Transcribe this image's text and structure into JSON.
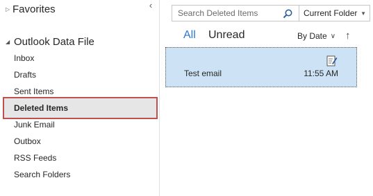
{
  "nav": {
    "favorites_label": "Favorites",
    "group_label": "Outlook Data File",
    "folders": [
      {
        "label": "Inbox"
      },
      {
        "label": "Drafts"
      },
      {
        "label": "Sent Items"
      },
      {
        "label": "Deleted Items",
        "selected": true
      },
      {
        "label": "Junk Email"
      },
      {
        "label": "Outbox"
      },
      {
        "label": "RSS Feeds"
      },
      {
        "label": "Search Folders"
      }
    ]
  },
  "search": {
    "placeholder": "Search Deleted Items",
    "scope_label": "Current Folder"
  },
  "filters": {
    "all_label": "All",
    "unread_label": "Unread",
    "sort_label": "By Date"
  },
  "messages": [
    {
      "subject": "Test email",
      "time": "11:55 AM"
    }
  ],
  "colors": {
    "accent": "#2b78d1",
    "selection_highlight": "#c0504d",
    "message_selected_bg": "#cde3f5"
  }
}
